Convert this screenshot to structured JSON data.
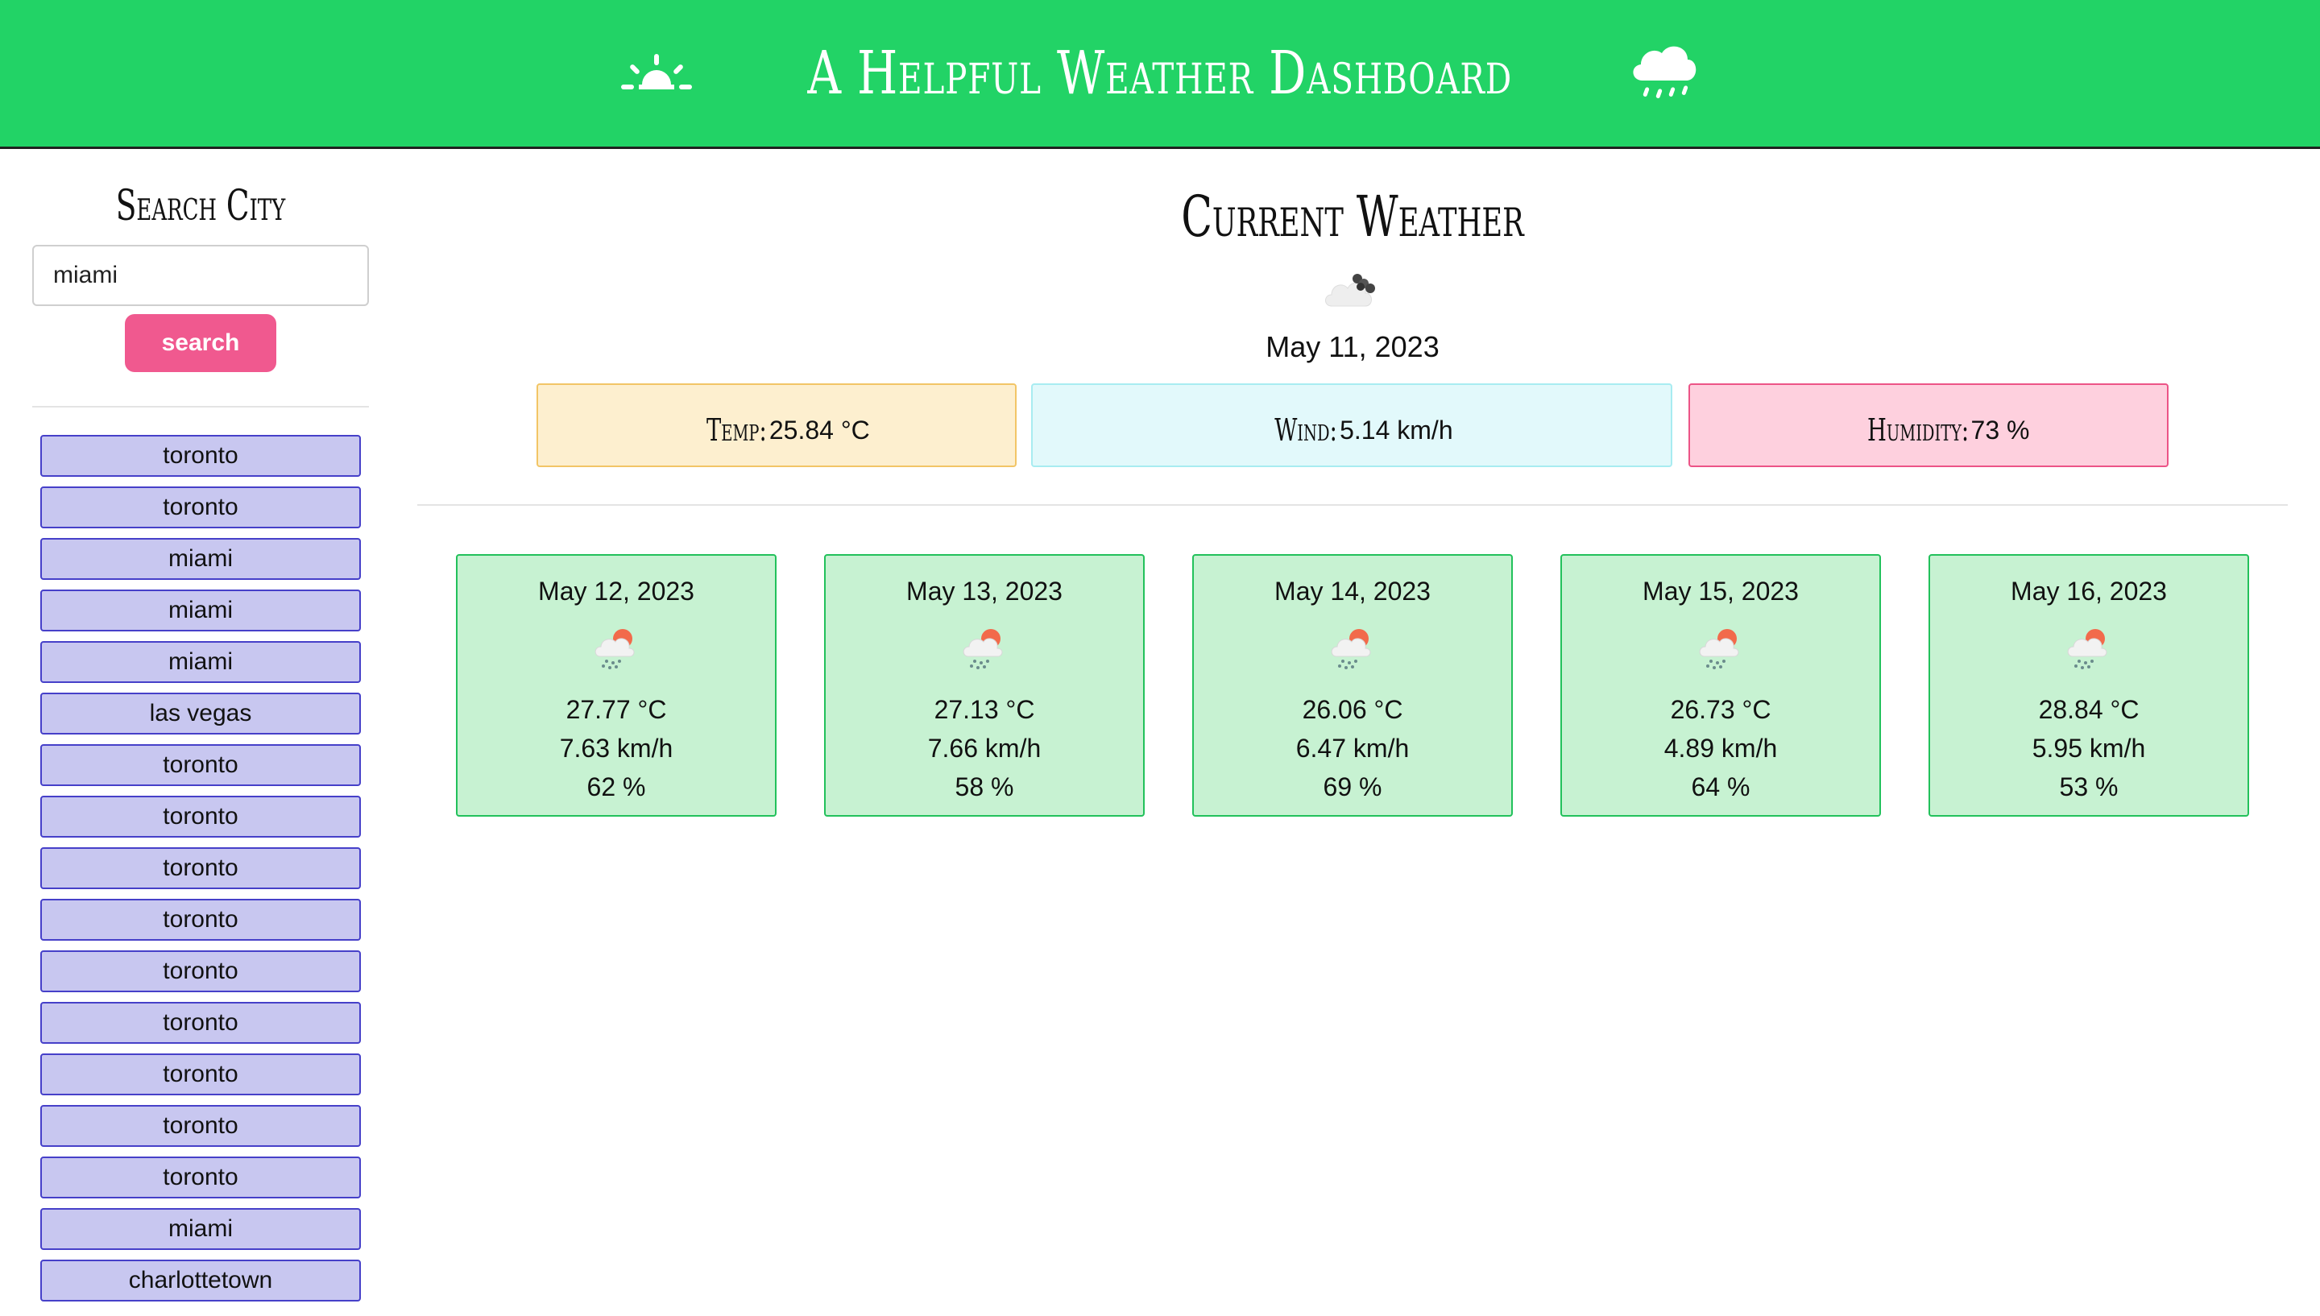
{
  "header": {
    "title": "A Helpful Weather Dashboard",
    "left_icon": "sun-horizon-icon",
    "right_icon": "rain-cloud-icon"
  },
  "sidebar": {
    "heading": "Search City",
    "search_value": "miami",
    "search_button": "search",
    "history": [
      "toronto",
      "toronto",
      "miami",
      "miami",
      "miami",
      "las vegas",
      "toronto",
      "toronto",
      "toronto",
      "toronto",
      "toronto",
      "toronto",
      "toronto",
      "toronto",
      "toronto",
      "miami",
      "charlottetown"
    ]
  },
  "current": {
    "heading": "Current Weather",
    "icon": "cloud-with-wind-icon",
    "date": "May 11, 2023",
    "temp_label": "Temp:",
    "temp_value": "25.84 °C",
    "wind_label": "Wind:",
    "wind_value": "5.14 km/h",
    "humidity_label": "Humidity:",
    "humidity_value": "73 %"
  },
  "forecast": [
    {
      "date": "May 12, 2023",
      "icon": "rain-sun-icon",
      "temp": "27.77 °C",
      "wind": "7.63 km/h",
      "humidity": "62 %"
    },
    {
      "date": "May 13, 2023",
      "icon": "rain-sun-icon",
      "temp": "27.13 °C",
      "wind": "7.66 km/h",
      "humidity": "58 %"
    },
    {
      "date": "May 14, 2023",
      "icon": "rain-sun-icon",
      "temp": "26.06 °C",
      "wind": "6.47 km/h",
      "humidity": "69 %"
    },
    {
      "date": "May 15, 2023",
      "icon": "rain-sun-icon",
      "temp": "26.73 °C",
      "wind": "4.89 km/h",
      "humidity": "64 %"
    },
    {
      "date": "May 16, 2023",
      "icon": "rain-sun-icon",
      "temp": "28.84 °C",
      "wind": "5.95 km/h",
      "humidity": "53 %"
    }
  ],
  "colors": {
    "header_bg": "#22d366",
    "search_button": "#f0598f",
    "history_bg": "#c8c7f0",
    "history_border": "#4640c9",
    "temp_bg": "#fdefcf",
    "wind_bg": "#e2f9fb",
    "humidity_bg": "#fed0de",
    "forecast_bg": "#c7f2d2"
  }
}
